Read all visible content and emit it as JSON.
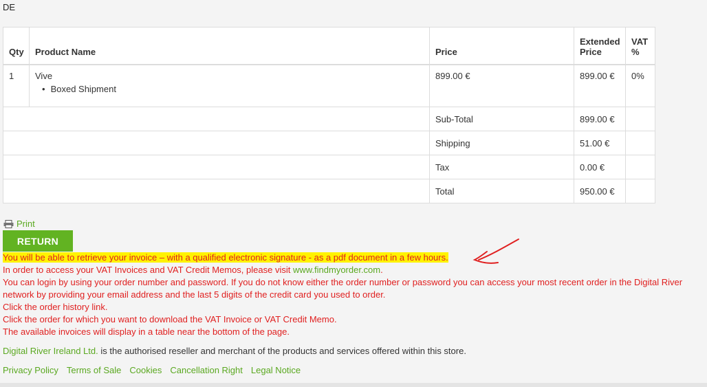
{
  "country_code": "DE",
  "table": {
    "headers": {
      "qty": "Qty",
      "product": "Product Name",
      "price": "Price",
      "extended": "Extended Price",
      "vat": "VAT %"
    },
    "item": {
      "qty": "1",
      "name": "Vive",
      "option": "Boxed Shipment",
      "price": "899.00 €",
      "extended": "899.00 €",
      "vat": "0%"
    },
    "summary": [
      {
        "label": "Sub-Total",
        "value": "899.00 €"
      },
      {
        "label": "Shipping",
        "value": "51.00 €"
      },
      {
        "label": "Tax",
        "value": "0.00 €"
      },
      {
        "label": "Total",
        "value": "950.00 €"
      }
    ]
  },
  "print_label": "Print",
  "return_label": "RETURN",
  "notice": {
    "highlight": "You will be able to retrieve your invoice – with a qualified electronic signature - as a pdf document in a few hours.",
    "line2_prefix": "In order to access your VAT Invoices and VAT Credit Memos, please visit ",
    "line2_link": "www.findmyorder.com",
    "line2_suffix": ".",
    "line3": "You can login by using your order number and password. If you do not know either the order number or password you can access your most recent order in the Digital River network by providing your email address and the last 5 digits of the credit card you used to order.",
    "line4": "Click the order history link.",
    "line5": "Click the order for which you want to download the VAT Invoice or VAT Credit Memo.",
    "line6": "The available invoices will display in a table near the bottom of the page."
  },
  "reseller": {
    "link": "Digital River Ireland Ltd.",
    "text": " is the authorised reseller and merchant of the products and services offered within this store."
  },
  "footer_links": [
    "Privacy Policy",
    "Terms of Sale",
    "Cookies",
    "Cancellation Right",
    "Legal Notice"
  ],
  "colors": {
    "accent": "#62b322",
    "link": "#5aa820",
    "notice": "#e02020",
    "highlight": "#fff200"
  }
}
